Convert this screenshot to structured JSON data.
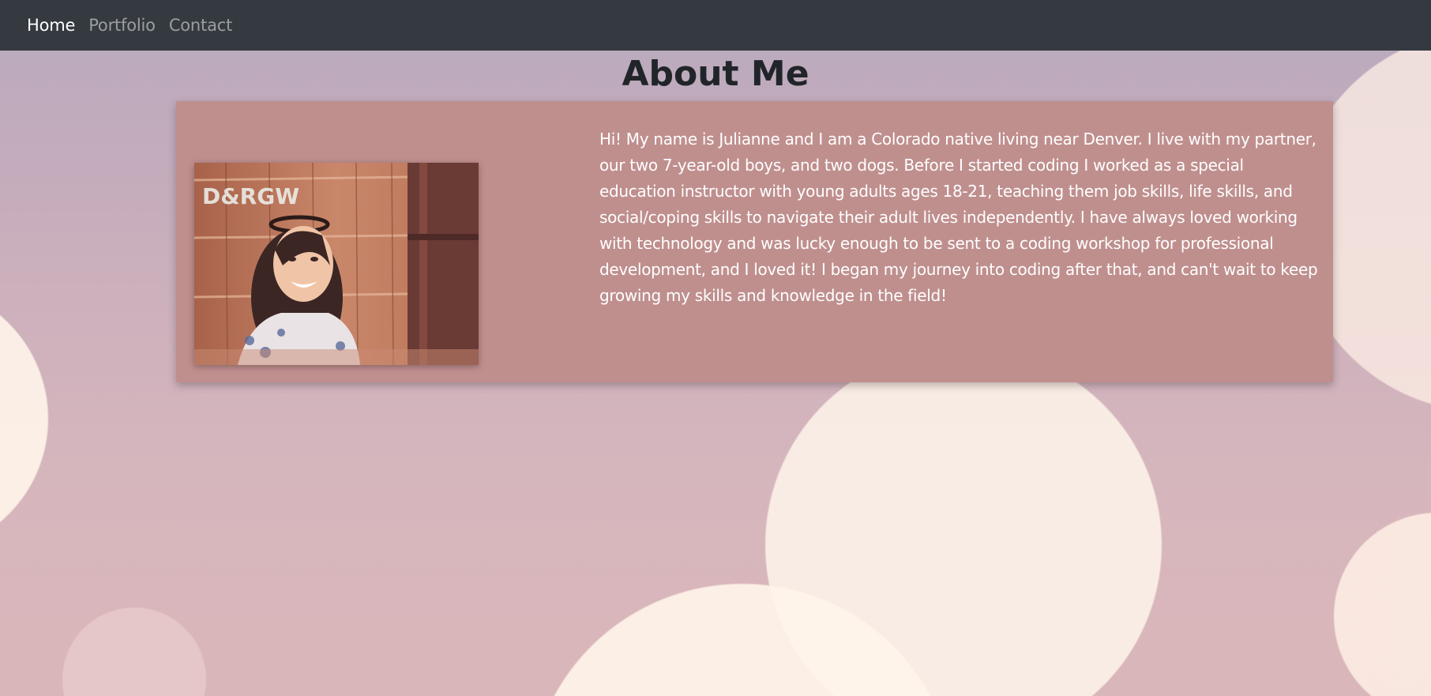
{
  "nav": {
    "items": [
      {
        "label": "Home",
        "active": true
      },
      {
        "label": "Portfolio",
        "active": false
      },
      {
        "label": "Contact",
        "active": false
      }
    ]
  },
  "about": {
    "title": "About Me",
    "photo_sign_text": "D&RGW",
    "bio": "Hi! My name is Julianne and I am a Colorado native living near Denver. I live with my partner, our two 7-year-old boys, and two dogs. Before I started coding I worked as a special education instructor with young adults ages 18-21, teaching them job skills, life skills, and social/coping skills to navigate their adult lives independently. I have always loved working with technology and was lucky enough to be sent to a coding workshop for professional development, and I loved it! I began my journey into coding after that, and can't wait to keep growing my skills and knowledge in the field!"
  },
  "colors": {
    "navbar": "#343a40",
    "card": "#bf8f8e",
    "title": "#212529"
  }
}
